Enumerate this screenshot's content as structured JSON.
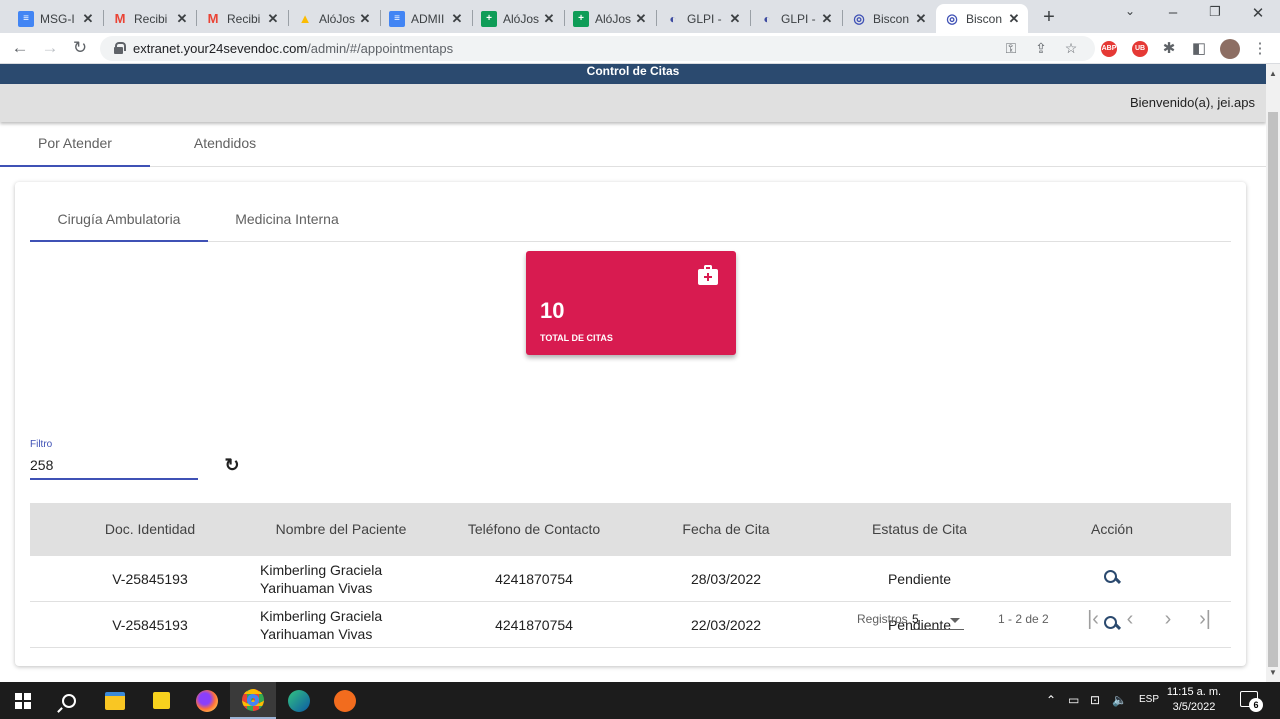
{
  "browser": {
    "tabs": [
      {
        "label": "MSG-I",
        "icon": "docs-icon",
        "color": "#4285f4"
      },
      {
        "label": "Recibi",
        "icon": "gmail-icon",
        "color": "#ea4335"
      },
      {
        "label": "Recibi",
        "icon": "gmail-icon",
        "color": "#ea4335"
      },
      {
        "label": "AlóJos",
        "icon": "drive-icon",
        "color": "#34a853"
      },
      {
        "label": "ADMII",
        "icon": "docs-icon",
        "color": "#4285f4"
      },
      {
        "label": "AlóJos",
        "icon": "sheets-icon",
        "color": "#0f9d58"
      },
      {
        "label": "AlóJos",
        "icon": "sheets-icon",
        "color": "#0f9d58"
      },
      {
        "label": "GLPI -",
        "icon": "glpi-icon",
        "color": "#e8eaed"
      },
      {
        "label": "GLPI -",
        "icon": "glpi-icon",
        "color": "#e8eaed"
      },
      {
        "label": "Biscon",
        "icon": "biscon-icon",
        "color": "#e8eaed"
      },
      {
        "label": "Biscon",
        "icon": "biscon-icon",
        "color": "#e8eaed"
      }
    ],
    "url_host": "extranet.your24sevendoc.com",
    "url_path": "/admin/#/appointmentaps",
    "extensions": [
      "ABP",
      "UB"
    ]
  },
  "app": {
    "header_title": "Control de Citas",
    "welcome": "Bienvenido(a), jei.aps",
    "main_tabs": [
      "Por Atender",
      "Atendidos"
    ],
    "sub_tabs": [
      "Cirugía Ambulatoria",
      "Medicina Interna"
    ],
    "stat": {
      "value": "10",
      "label": "TOTAL DE CITAS",
      "color": "#d81b50",
      "icon": "medical-kit-icon"
    },
    "filter": {
      "label": "Filtro",
      "value": "258"
    },
    "table": {
      "headers": [
        "Doc. Identidad",
        "Nombre del Paciente",
        "Teléfono de Contacto",
        "Fecha de Cita",
        "Estatus de Cita",
        "Acción"
      ],
      "rows": [
        {
          "doc": "V-25845193",
          "name_line1": "Kimberling Graciela",
          "name_line2": "Yarihuaman Vivas",
          "phone": "4241870754",
          "date": "28/03/2022",
          "status": "Pendiente"
        },
        {
          "doc": "V-25845193",
          "name_line1": "Kimberling Graciela",
          "name_line2": "Yarihuaman Vivas",
          "phone": "4241870754",
          "date": "22/03/2022",
          "status": "Pendiente"
        }
      ]
    },
    "paginator": {
      "label": "Registros",
      "page_size": "5",
      "range": "1 - 2 de 2"
    }
  },
  "taskbar": {
    "lang": "ESP",
    "time": "11:15 a. m.",
    "date": "3/5/2022",
    "notifications": "6"
  }
}
